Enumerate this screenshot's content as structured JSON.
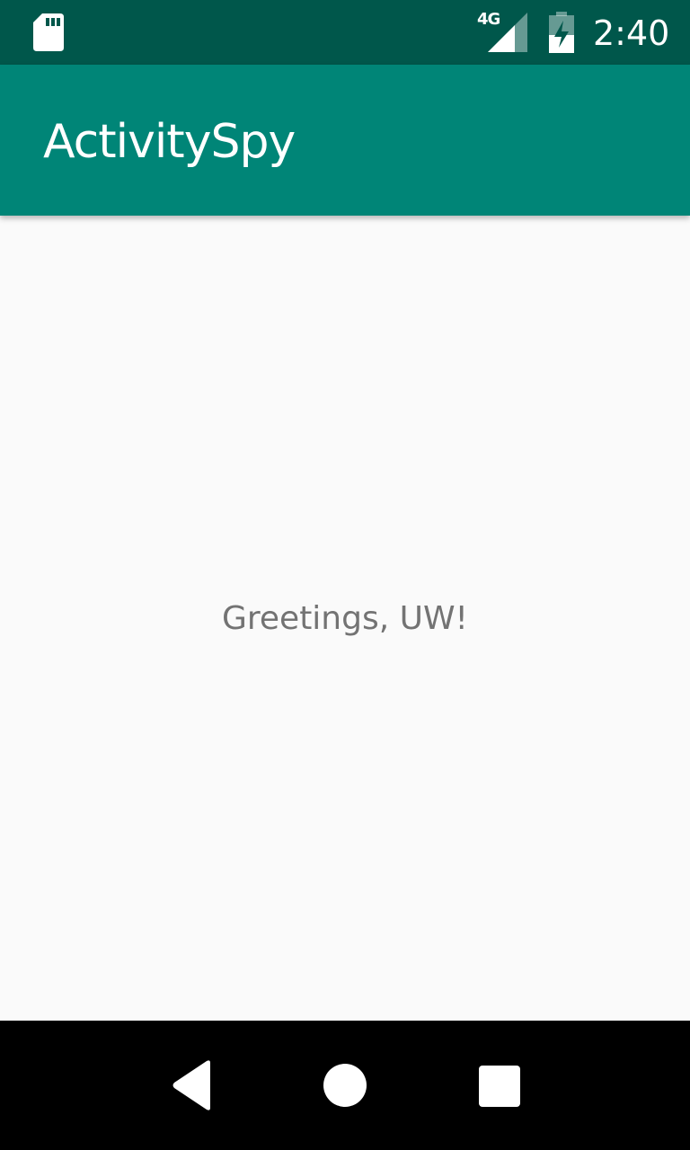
{
  "status_bar": {
    "network_type": "4G",
    "time": "2:40",
    "icons": [
      "sd-card-icon",
      "signal-icon",
      "battery-charging-icon"
    ]
  },
  "app_bar": {
    "title": "ActivitySpy"
  },
  "main": {
    "greeting": "Greetings, UW!"
  },
  "nav_bar": {
    "icons": [
      "back-icon",
      "home-icon",
      "recents-icon"
    ]
  },
  "colors": {
    "status_bar": "#00574b",
    "app_bar": "#008577",
    "background": "#fafafa",
    "text_secondary": "#737373",
    "nav_bar": "#000000"
  }
}
